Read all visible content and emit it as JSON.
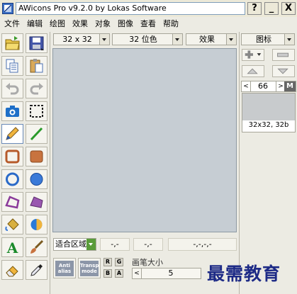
{
  "window": {
    "title": "AWicons Pro v9.2.0 by Lokas Software",
    "help_button": "?",
    "minimize_button": "_",
    "close_button": "X"
  },
  "menu": [
    "文件",
    "编辑",
    "绘图",
    "效果",
    "对象",
    "图像",
    "查看",
    "帮助"
  ],
  "toolbar": {
    "size": "32 x 32",
    "color_depth": "32 位色",
    "effects": "效果",
    "icon_menu": "图标"
  },
  "tools": [
    "open-folder-icon",
    "save-icon",
    "copy-icon",
    "paste-icon",
    "undo-icon",
    "redo-icon",
    "camera-icon",
    "selection-icon",
    "pencil-icon",
    "line-icon",
    "rectangle-icon",
    "filled-rectangle-icon",
    "ellipse-icon",
    "filled-ellipse-icon",
    "polygon-icon",
    "filled-polygon-icon",
    "fill-bucket-icon",
    "transparency-icon",
    "text-icon",
    "brush-icon",
    "eraser-icon",
    "eyedropper-icon"
  ],
  "status": {
    "zoom": "适合区域",
    "coord1": "-,-",
    "coord2": "-,-",
    "coord3": "-,-,-,-"
  },
  "bottom": {
    "antialias": "Anti alias",
    "transp": "Transp mode",
    "r": "R",
    "g": "G",
    "b": "B",
    "a": "A",
    "brush_label": "画笔大小",
    "brush_size": "5"
  },
  "right_panel": {
    "page": "66",
    "m": "M",
    "thumb_caption": "32x32, 32b"
  },
  "watermark": "最需教育"
}
